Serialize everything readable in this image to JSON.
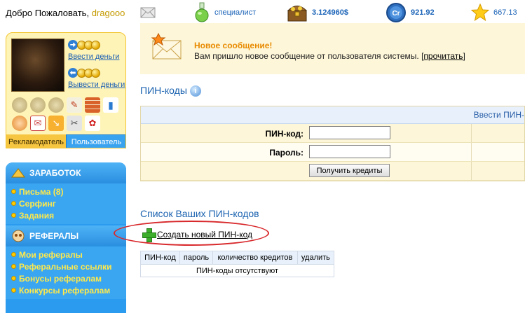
{
  "topbar": {
    "welcome": "Добро Пожаловать,",
    "username": "dragooo",
    "status_label": "специалист",
    "balance": "3.124960$",
    "credits": "921.92",
    "rating": "667.13"
  },
  "profile": {
    "deposit_label": "Ввести деньги",
    "withdraw_label": "Вывести деньги",
    "tab_advertiser": "Рекламодатель",
    "tab_user": "Пользователь"
  },
  "menu": {
    "earn_title": "ЗАРАБОТОК",
    "earn_items": [
      "Письма (8)",
      "Серфинг",
      "Задания"
    ],
    "ref_title": "РЕФЕРАЛЫ",
    "ref_items": [
      "Мои рефералы",
      "Реферальные ссылки",
      "Бонусы рефералам",
      "Конкурсы рефералам"
    ]
  },
  "notice": {
    "title": "Новое сообщение!",
    "text": "Вам пришло новое сообщение от пользователя системы. [",
    "link": "прочитать",
    "text_end": "]"
  },
  "pin_section": {
    "title": "ПИН-коды",
    "header": "Ввести ПИН-",
    "pin_label": "ПИН-код:",
    "password_label": "Пароль:",
    "pin_value": "",
    "password_value": "",
    "submit_label": "Получить кредиты"
  },
  "list_section": {
    "title": "Список Ваших ПИН-кодов",
    "create_label": "Создать новый ПИН-код",
    "columns": [
      "ПИН-код",
      "пароль",
      "количество кредитов",
      "удалить"
    ],
    "empty_text": "ПИН-коды отсутствуют"
  },
  "colors": {
    "accent_blue": "#1c63b0",
    "menu_blue": "#2b9bf0",
    "menu_text": "#ffe94a",
    "notice_bg": "#fdf6d8",
    "highlight_red": "#d8282b"
  }
}
